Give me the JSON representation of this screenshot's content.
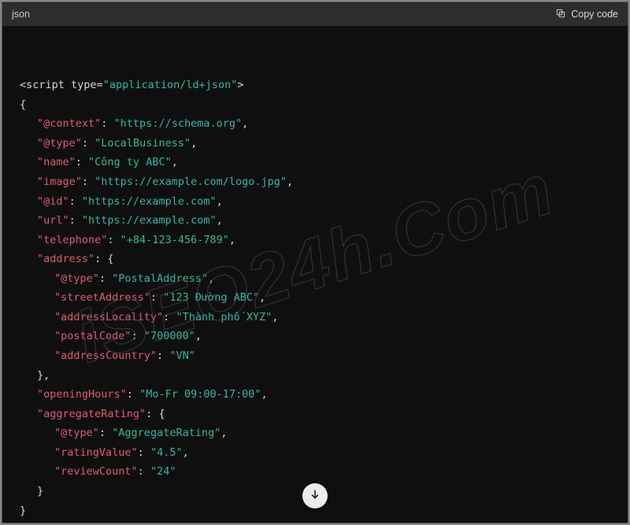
{
  "header": {
    "language_label": "json",
    "copy_label": "Copy code"
  },
  "watermark_text": "iSEO24h.Com",
  "tokens": {
    "script_open_1": "<script",
    "type_attr": " type",
    "eq": "=",
    "type_val": "\"application/ld+json\"",
    "script_open_2": ">",
    "brace_open": "{",
    "brace_close": "}",
    "bracket_open": "{",
    "bracket_close_comma": "},",
    "colon_sp": ": ",
    "comma": ","
  },
  "kv": {
    "context_k": "\"@context\"",
    "context_v": "\"https://schema.org\"",
    "type_k": "\"@type\"",
    "type_v": "\"LocalBusiness\"",
    "name_k": "\"name\"",
    "name_v": "\"Công ty ABC\"",
    "image_k": "\"image\"",
    "image_v": "\"https://example.com/logo.jpg\"",
    "id_k": "\"@id\"",
    "id_v": "\"https://example.com\"",
    "url_k": "\"url\"",
    "url_v": "\"https://example.com\"",
    "tel_k": "\"telephone\"",
    "tel_v": "\"+84-123-456-789\"",
    "address_k": "\"address\"",
    "a_type_k": "\"@type\"",
    "a_type_v": "\"PostalAddress\"",
    "a_street_k": "\"streetAddress\"",
    "a_street_v": "\"123 Đường ABC\"",
    "a_loc_k": "\"addressLocality\"",
    "a_loc_v": "\"Thành phố XYZ\"",
    "a_postal_k": "\"postalCode\"",
    "a_postal_v": "\"700000\"",
    "a_country_k": "\"addressCountry\"",
    "a_country_v": "\"VN\"",
    "hours_k": "\"openingHours\"",
    "hours_v": "\"Mo-Fr 09:00-17:00\"",
    "agg_k": "\"aggregateRating\"",
    "r_type_k": "\"@type\"",
    "r_type_v": "\"AggregateRating\"",
    "r_val_k": "\"ratingValue\"",
    "r_val_v": "\"4.5\"",
    "r_count_k": "\"reviewCount\"",
    "r_count_v": "\"24\""
  }
}
